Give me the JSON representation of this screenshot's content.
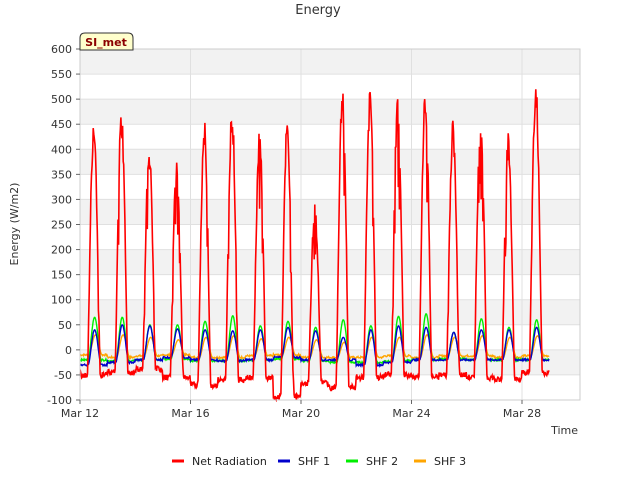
{
  "chart_data": {
    "type": "line",
    "title": "Energy",
    "xlabel": "Time",
    "ylabel": "Energy (W/m2)",
    "badge": "SI_met",
    "xlim": [
      0,
      18.1
    ],
    "ylim": [
      -100,
      600
    ],
    "yticks": [
      -100,
      -50,
      0,
      50,
      100,
      150,
      200,
      250,
      300,
      350,
      400,
      450,
      500,
      550,
      600
    ],
    "xticks": [
      {
        "value": 0,
        "label": "Mar 12"
      },
      {
        "value": 4,
        "label": "Mar 16"
      },
      {
        "value": 8,
        "label": "Mar 20"
      },
      {
        "value": 12,
        "label": "Mar 24"
      },
      {
        "value": 16,
        "label": "Mar 28"
      }
    ],
    "grid": true,
    "legend_position": "bottom",
    "series": [
      {
        "name": "Net Radiation",
        "color": "#ff0000",
        "daily_peak": [
          475,
          483,
          413,
          387,
          460,
          492,
          448,
          460,
          293,
          535,
          523,
          516,
          525,
          462,
          487,
          435,
          552
        ],
        "night_min": [
          -50,
          -45,
          -38,
          -55,
          -70,
          -60,
          -55,
          -95,
          -65,
          -75,
          -55,
          -50,
          -55,
          -50,
          -55,
          -60,
          -45
        ]
      },
      {
        "name": "SHF 1",
        "color": "#0000cc",
        "daily_peak": [
          40,
          50,
          48,
          42,
          40,
          38,
          40,
          45,
          38,
          25,
          40,
          48,
          45,
          35,
          40,
          40,
          45
        ],
        "night_min": [
          -30,
          -25,
          -20,
          -15,
          -20,
          -22,
          -20,
          -15,
          -20,
          -20,
          -30,
          -25,
          -20,
          -20,
          -20,
          -20,
          -20
        ]
      },
      {
        "name": "SHF 2",
        "color": "#00ee00",
        "daily_peak": [
          65,
          65,
          50,
          50,
          57,
          68,
          48,
          57,
          45,
          60,
          48,
          67,
          72,
          35,
          62,
          45,
          60
        ],
        "night_min": [
          -20,
          -22,
          -20,
          -18,
          -22,
          -22,
          -20,
          -18,
          -22,
          -25,
          -25,
          -22,
          -20,
          -18,
          -20,
          -20,
          -20
        ]
      },
      {
        "name": "SHF 3",
        "color": "#ffa500",
        "daily_peak": [
          30,
          30,
          25,
          20,
          25,
          28,
          22,
          25,
          20,
          15,
          25,
          25,
          30,
          25,
          28,
          25,
          28
        ],
        "night_min": [
          -10,
          -15,
          -12,
          -10,
          -15,
          -15,
          -12,
          -10,
          -15,
          -15,
          -15,
          -12,
          -15,
          -12,
          -12,
          -15,
          -12
        ]
      }
    ]
  }
}
